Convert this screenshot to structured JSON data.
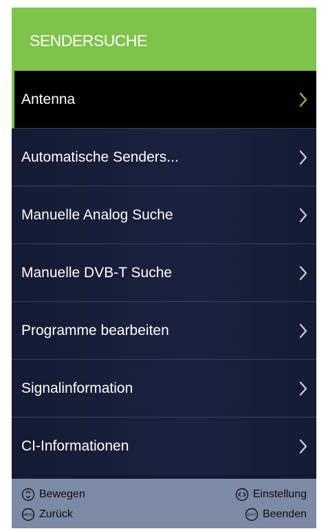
{
  "header": {
    "title": "SENDERSUCHE"
  },
  "colors": {
    "accent": "#7ec34a",
    "panel_background": "#121a30",
    "selected_background": "#000000",
    "footer_background": "#7d8aa6",
    "chevron_default": "#c8ccd8",
    "chevron_selected": "#7ec34a"
  },
  "menu": {
    "items": [
      {
        "label": "Antenna",
        "selected": true
      },
      {
        "label": "Automatische Senders...",
        "selected": false
      },
      {
        "label": "Manuelle Analog Suche",
        "selected": false
      },
      {
        "label": "Manuelle DVB-T Suche",
        "selected": false
      },
      {
        "label": "Programme bearbeiten",
        "selected": false
      },
      {
        "label": "Signalinformation",
        "selected": false
      },
      {
        "label": "CI-Informationen",
        "selected": false
      }
    ]
  },
  "footer": {
    "move": {
      "icon": "up-down-icon",
      "label": "Bewegen"
    },
    "setting": {
      "icon": "left-right-icon",
      "label": "Einstellung"
    },
    "back": {
      "icon": "menu-key-icon",
      "key_text": "MENU",
      "label": "Zurück"
    },
    "exit": {
      "icon": "exit-key-icon",
      "key_text": "EXIT",
      "label": "Beenden"
    }
  }
}
